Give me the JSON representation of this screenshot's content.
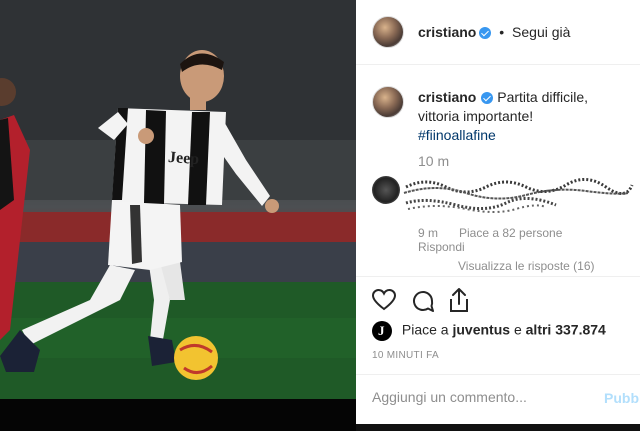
{
  "header": {
    "username": "cristiano",
    "separator": "•",
    "follow_label": "Segui già"
  },
  "caption": {
    "username": "cristiano",
    "text": "Partita difficile, vittoria importante!",
    "hashtag": "#fiinoallafine",
    "time": "10 m"
  },
  "reply": {
    "time": "9 m",
    "likes": "Piace a 82 persone",
    "reply_label": "Rispondi",
    "view_replies": "Visualizza le risposte (16)"
  },
  "actions": {
    "liked_prefix": "Piace a",
    "liked_user": "juventus",
    "liked_mid": "e",
    "liked_others": "altri 337.874",
    "timestamp": "10 MINUTI FA"
  },
  "comment_box": {
    "placeholder": "Aggiungi un commento...",
    "publish_label": "Pubbl"
  },
  "photo": {
    "jersey_text": "Jeep"
  },
  "colors": {
    "verified": "#3897f0",
    "hashtag": "#00376b",
    "muted": "#8e8e8e",
    "publish": "#b2dffc"
  },
  "icons": [
    "verified-badge-icon",
    "heart-icon",
    "comment-icon",
    "share-icon",
    "juventus-logo-icon"
  ]
}
